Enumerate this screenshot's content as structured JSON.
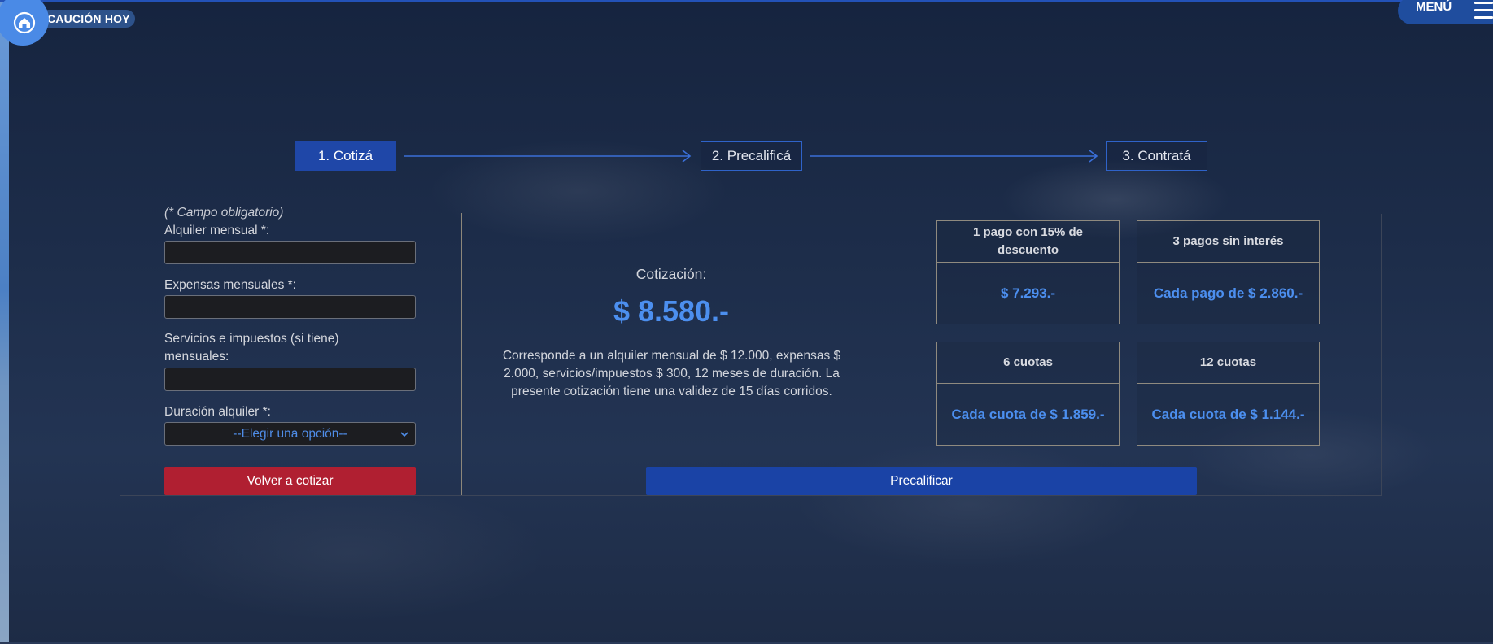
{
  "header": {
    "logo_text": "CAUCIÓN HOY",
    "menu_label": "MENÚ"
  },
  "steps": [
    {
      "label": "1. Cotizá"
    },
    {
      "label": "2. Precalificá"
    },
    {
      "label": "3. Contratá"
    }
  ],
  "form": {
    "required_note": "(* Campo obligatorio)",
    "rent_label": "Alquiler mensual *:",
    "rent_value": "",
    "expenses_label": "Expensas mensuales *:",
    "expenses_value": "",
    "services_label_line1": "Servicios e impuestos (si tiene)",
    "services_label_line2": "mensuales:",
    "services_value": "",
    "duration_label": "Duración alquiler *:",
    "duration_selected": "--Elegir una opción--",
    "requote_button": "Volver a cotizar"
  },
  "quote": {
    "label": "Cotización:",
    "amount": "$ 8.580.-",
    "description": "Corresponde a un alquiler mensual de $ 12.000, expensas $ 2.000, servicios/impuestos $ 300, 12 meses de duración. La presente cotización tiene una validez de 15 días corridos."
  },
  "payment_options": [
    {
      "title": "1 pago con 15% de descuento",
      "value": "$ 7.293.-"
    },
    {
      "title": "3 pagos sin interés",
      "value": "Cada pago de $ 2.860.-"
    },
    {
      "title": "6 cuotas",
      "value": "Cada cuota de $ 1.859.-"
    },
    {
      "title": "12 cuotas",
      "value": "Cada cuota de $ 1.144.-"
    }
  ],
  "actions": {
    "prequalify_button": "Precalificar"
  },
  "colors": {
    "accent_blue": "#1f47a8",
    "amount_blue": "#4c8fef",
    "danger_red": "#b01f31"
  }
}
